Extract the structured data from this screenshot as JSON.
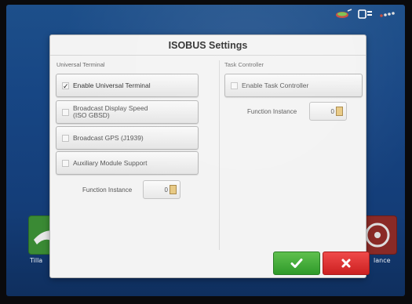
{
  "dialog": {
    "title": "ISOBUS Settings"
  },
  "universal_terminal": {
    "section_label": "Universal Terminal",
    "options": [
      {
        "label": "Enable Universal Terminal",
        "checked": true
      },
      {
        "label": "Broadcast Display Speed\n(ISO GBSD)",
        "checked": false
      },
      {
        "label": "Broadcast GPS (J1939)",
        "checked": false
      },
      {
        "label": "Auxiliary Module Support",
        "checked": false
      }
    ],
    "function_instance_label": "Function Instance",
    "function_instance_value": "0"
  },
  "task_controller": {
    "section_label": "Task Controller",
    "options": [
      {
        "label": "Enable Task Controller",
        "checked": false
      }
    ],
    "function_instance_label": "Function Instance",
    "function_instance_value": "0"
  },
  "background": {
    "left_tile_label": "Tilla",
    "right_tile_label": "lance"
  },
  "icons": {
    "ok": "checkmark-icon",
    "cancel": "x-icon",
    "keyboard": "keypad-icon",
    "satellite": "satellite-icon",
    "screen": "display-icon",
    "signal": "signal-icon"
  },
  "colors": {
    "ok_green": "#3aa832",
    "cancel_red": "#e02d2d",
    "screen_blue": "#174684"
  }
}
